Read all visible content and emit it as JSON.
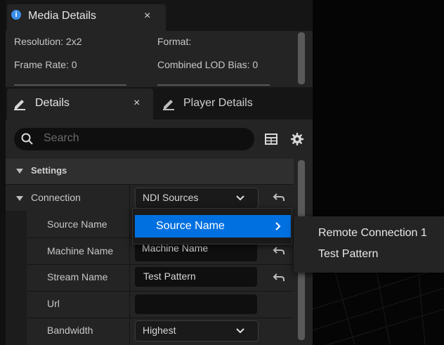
{
  "media_details": {
    "tab_label": "Media Details",
    "rows": [
      {
        "left": "Resolution: 2x2",
        "right": "Format:"
      },
      {
        "left": "Frame Rate: 0",
        "right": "Combined LOD Bias: 0"
      }
    ]
  },
  "details": {
    "tabs": [
      {
        "label": "Details"
      },
      {
        "label": "Player Details"
      }
    ],
    "close_glyph": "×",
    "search_placeholder": "Search",
    "category": "Settings",
    "properties": {
      "connection": {
        "label": "Connection",
        "value": "NDI Sources"
      },
      "source_name": {
        "label": "Source Name"
      },
      "machine_name": {
        "label": "Machine Name",
        "value": "Machine Name"
      },
      "stream_name": {
        "label": "Stream Name",
        "value": "Test Pattern"
      },
      "url": {
        "label": "Url",
        "value": ""
      },
      "bandwidth": {
        "label": "Bandwidth",
        "value": "Highest"
      }
    }
  },
  "menu": {
    "item": "Source Name",
    "submenu": [
      "Remote Connection 1",
      "Test Pattern"
    ]
  },
  "icons": {
    "info": "info-icon",
    "details": "details-icon",
    "search": "search-icon",
    "table": "table-view-icon",
    "settings": "gear-icon",
    "reset": "reset-to-default-icon",
    "dropdown": "chevron-down-icon",
    "submenu": "chevron-right-icon"
  },
  "colors": {
    "accent": "#0070e0",
    "info_badge": "#3b8ee8"
  }
}
